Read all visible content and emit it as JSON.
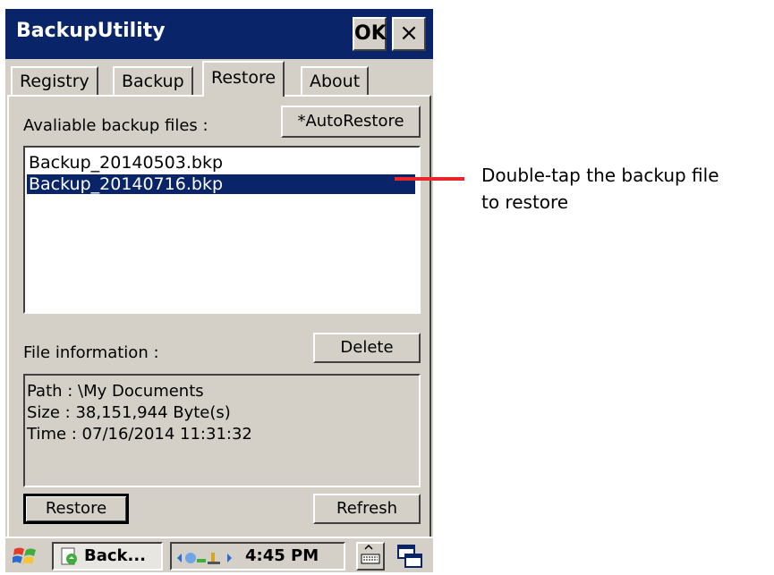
{
  "window": {
    "title": "BackupUtility",
    "ok_label": "OK",
    "close_label": "×"
  },
  "tabs": [
    {
      "label": "Registry"
    },
    {
      "label": "Backup"
    },
    {
      "label": "Restore"
    },
    {
      "label": "About"
    }
  ],
  "restore": {
    "available_label": "Avaliable backup files :",
    "autorestore_label": "*AutoRestore",
    "files": [
      {
        "name": "Backup_20140503.bkp"
      },
      {
        "name": "Backup_20140716.bkp"
      }
    ],
    "file_info_label": "File information :",
    "delete_label": "Delete",
    "info": {
      "path": "Path : \\My Documents",
      "size": "Size : 38,151,944 Byte(s)",
      "time": "Time : 07/16/2014 11:31:32"
    },
    "restore_label": "Restore",
    "refresh_label": "Refresh"
  },
  "taskbar": {
    "app_label": "Back...",
    "clock": "4:45 PM"
  },
  "annotation": {
    "line1": "Double-tap the backup file",
    "line2": "to restore",
    "color": "#e8262c"
  }
}
